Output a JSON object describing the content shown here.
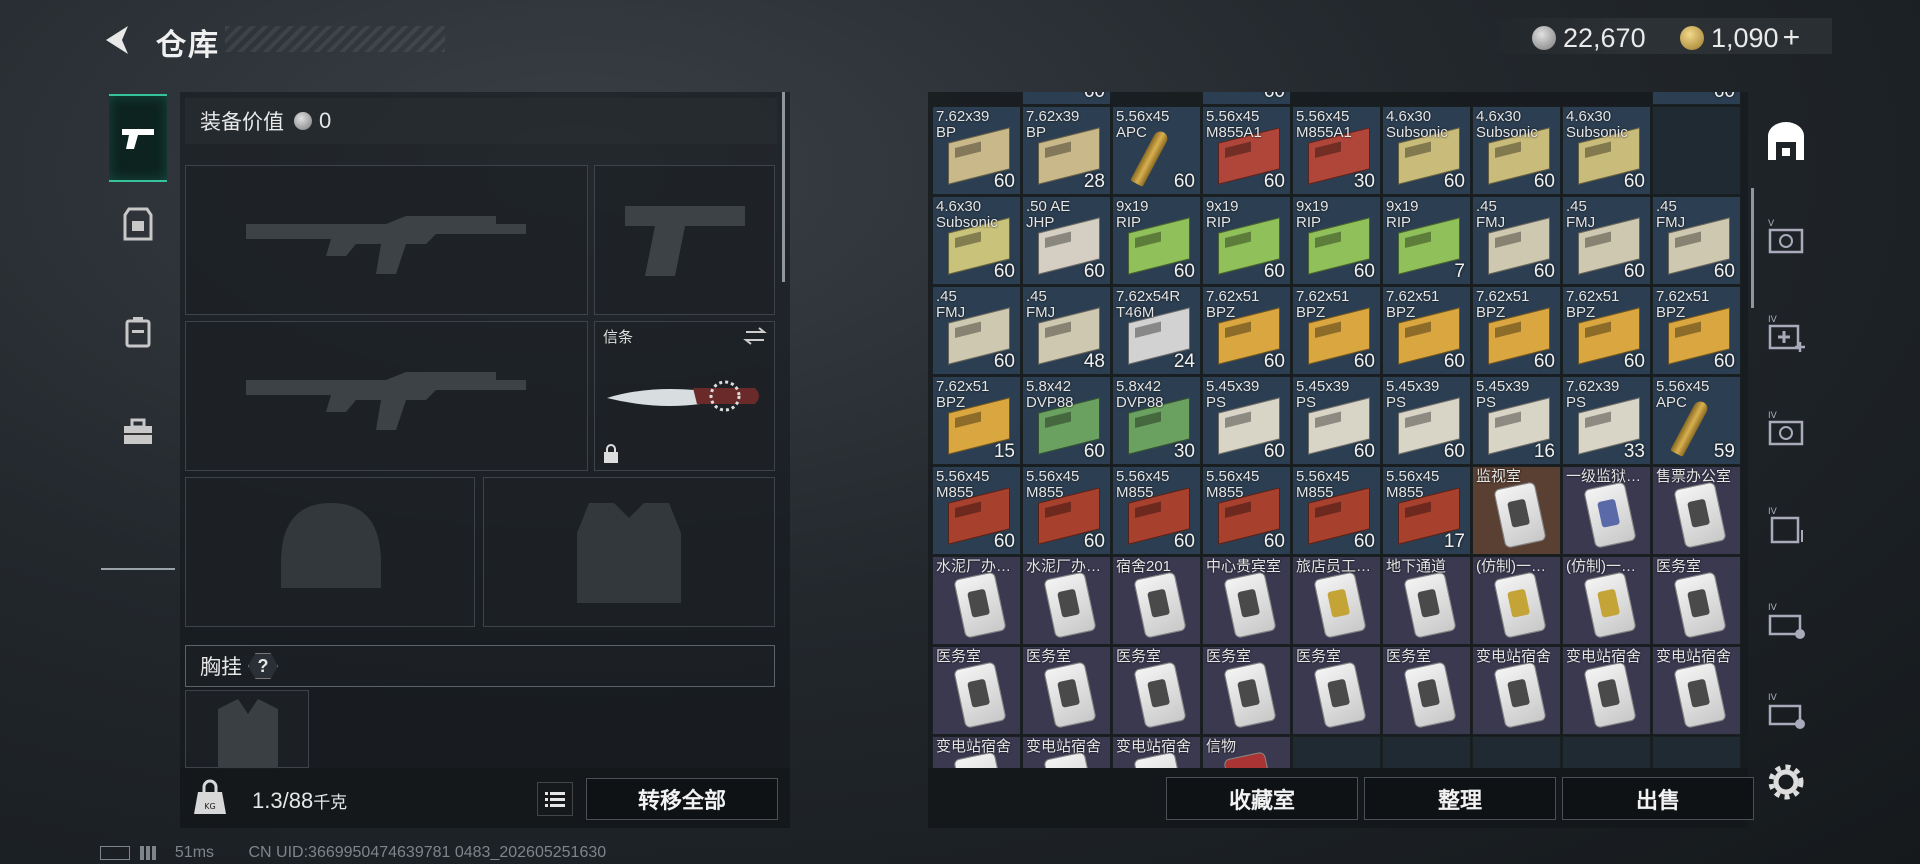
{
  "header": {
    "title": "仓库",
    "currency_silver": "22,670",
    "currency_gold": "1,090",
    "plus": "+"
  },
  "loadout": {
    "equip_value_label": "装备价值",
    "equip_value": "0",
    "knife_label": "信条",
    "chest_label": "胸挂",
    "chest_help": "?",
    "weight_current": "1.3",
    "weight_max": "/88",
    "weight_unit": "千克",
    "transfer_all": "转移全部"
  },
  "actions": {
    "collection_room": "收藏室",
    "organize": "整理",
    "sell": "出售"
  },
  "status": {
    "ping": "51ms",
    "uid": "CN UID:3669950474639781 0483_202605251630"
  },
  "colors": {
    "accent": "#36c39a",
    "ammo_slot": "#2c3f52",
    "key_slot": "#3a3950"
  },
  "inventory": {
    "top_partial": [
      "60",
      "60",
      "60"
    ],
    "rows": [
      [
        {
          "name": "7.62x39\nBP",
          "count": "60",
          "icon": "ammo-box",
          "tint": "#c9b98a"
        },
        {
          "name": "7.62x39\nBP",
          "count": "28",
          "icon": "ammo-box",
          "tint": "#c9b98a"
        },
        {
          "name": "5.56x45\nAPC",
          "count": "60",
          "icon": "bullet",
          "tint": "#9b3a2a"
        },
        {
          "name": "5.56x45\nM855A1",
          "count": "60",
          "icon": "ammo-box",
          "tint": "#b0453a"
        },
        {
          "name": "5.56x45\nM855A1",
          "count": "30",
          "icon": "ammo-box",
          "tint": "#b0453a"
        },
        {
          "name": "4.6x30\nSubsonic",
          "count": "60",
          "icon": "ammo-box",
          "tint": "#c9bb7a"
        },
        {
          "name": "4.6x30\nSubsonic",
          "count": "60",
          "icon": "ammo-box",
          "tint": "#c9bb7a"
        },
        {
          "name": "4.6x30\nSubsonic",
          "count": "60",
          "icon": "ammo-box",
          "tint": "#c9bb7a"
        }
      ],
      [
        {
          "name": "4.6x30\nSubsonic",
          "count": "60",
          "icon": "ammo-box",
          "tint": "#c9c27a"
        },
        {
          "name": ".50 AE\nJHP",
          "count": "60",
          "icon": "ammo-box",
          "tint": "#d4cfc2"
        },
        {
          "name": "9x19\nRIP",
          "count": "60",
          "icon": "ammo-box",
          "tint": "#8fc05a"
        },
        {
          "name": "9x19\nRIP",
          "count": "60",
          "icon": "ammo-box",
          "tint": "#8fc05a"
        },
        {
          "name": "9x19\nRIP",
          "count": "60",
          "icon": "ammo-box",
          "tint": "#8fc05a"
        },
        {
          "name": "9x19\nRIP",
          "count": "7",
          "icon": "ammo-box",
          "tint": "#8fc05a"
        },
        {
          "name": ".45\nFMJ",
          "count": "60",
          "icon": "ammo-box",
          "tint": "#cfc8b0"
        },
        {
          "name": ".45\nFMJ",
          "count": "60",
          "icon": "ammo-box",
          "tint": "#cfc8b0"
        },
        {
          "name": ".45\nFMJ",
          "count": "60",
          "icon": "ammo-box",
          "tint": "#cfc8b0"
        }
      ],
      [
        {
          "name": ".45\nFMJ",
          "count": "60",
          "icon": "ammo-box",
          "tint": "#cfc8b0"
        },
        {
          "name": ".45\nFMJ",
          "count": "48",
          "icon": "ammo-box",
          "tint": "#cfc8b0"
        },
        {
          "name": "7.62x54R\nT46M",
          "count": "24",
          "icon": "ammo-box",
          "tint": "#d2d2d2"
        },
        {
          "name": "7.62x51\nBPZ",
          "count": "60",
          "icon": "ammo-box",
          "tint": "#d9a640"
        },
        {
          "name": "7.62x51\nBPZ",
          "count": "60",
          "icon": "ammo-box",
          "tint": "#d9a640"
        },
        {
          "name": "7.62x51\nBPZ",
          "count": "60",
          "icon": "ammo-box",
          "tint": "#d9a640"
        },
        {
          "name": "7.62x51\nBPZ",
          "count": "60",
          "icon": "ammo-box",
          "tint": "#d9a640"
        },
        {
          "name": "7.62x51\nBPZ",
          "count": "60",
          "icon": "ammo-box",
          "tint": "#d9a640"
        },
        {
          "name": "7.62x51\nBPZ",
          "count": "60",
          "icon": "ammo-box",
          "tint": "#d9a640"
        }
      ],
      [
        {
          "name": "7.62x51\nBPZ",
          "count": "15",
          "icon": "ammo-box",
          "tint": "#d9a640"
        },
        {
          "name": "5.8x42\nDVP88",
          "count": "60",
          "icon": "ammo-box",
          "tint": "#6aa060"
        },
        {
          "name": "5.8x42\nDVP88",
          "count": "30",
          "icon": "ammo-box",
          "tint": "#6aa060"
        },
        {
          "name": "5.45x39\nPS",
          "count": "60",
          "icon": "ammo-box",
          "tint": "#d8d4c6"
        },
        {
          "name": "5.45x39\nPS",
          "count": "60",
          "icon": "ammo-box",
          "tint": "#d8d4c6"
        },
        {
          "name": "5.45x39\nPS",
          "count": "60",
          "icon": "ammo-box",
          "tint": "#d8d4c6"
        },
        {
          "name": "5.45x39\nPS",
          "count": "16",
          "icon": "ammo-box",
          "tint": "#d8d4c6"
        },
        {
          "name": "7.62x39\nPS",
          "count": "33",
          "icon": "ammo-box",
          "tint": "#d8d4c6"
        },
        {
          "name": "5.56x45\nAPC",
          "count": "59",
          "icon": "bullet",
          "tint": "#9b3a2a"
        }
      ],
      [
        {
          "name": "5.56x45\nM855",
          "count": "60",
          "icon": "ammo-box",
          "tint": "#a8402e"
        },
        {
          "name": "5.56x45\nM855",
          "count": "60",
          "icon": "ammo-box",
          "tint": "#a8402e"
        },
        {
          "name": "5.56x45\nM855",
          "count": "60",
          "icon": "ammo-box",
          "tint": "#a8402e"
        },
        {
          "name": "5.56x45\nM855",
          "count": "60",
          "icon": "ammo-box",
          "tint": "#a8402e"
        },
        {
          "name": "5.56x45\nM855",
          "count": "60",
          "icon": "ammo-box",
          "tint": "#a8402e"
        },
        {
          "name": "5.56x45\nM855",
          "count": "17",
          "icon": "ammo-box",
          "tint": "#a8402e"
        },
        {
          "name": "监视室",
          "count": "",
          "icon": "keycard",
          "slot": "gold"
        },
        {
          "name": "一级监狱…",
          "count": "",
          "icon": "keycard-blue",
          "slot": "key"
        },
        {
          "name": "售票办公室",
          "count": "",
          "icon": "keycard",
          "slot": "key"
        }
      ],
      [
        {
          "name": "水泥厂办…",
          "count": "",
          "icon": "keycard",
          "slot": "key"
        },
        {
          "name": "水泥厂办…",
          "count": "",
          "icon": "keycard",
          "slot": "key"
        },
        {
          "name": "宿舍201",
          "count": "",
          "icon": "keycard",
          "slot": "key"
        },
        {
          "name": "中心贵宾室",
          "count": "",
          "icon": "keycard",
          "slot": "key"
        },
        {
          "name": "旅店员工…",
          "count": "",
          "icon": "keycard-yellow",
          "slot": "key"
        },
        {
          "name": "地下通道",
          "count": "",
          "icon": "keycard",
          "slot": "key"
        },
        {
          "name": "(仿制)一…",
          "count": "",
          "icon": "keycard-yellow",
          "slot": "key"
        },
        {
          "name": "(仿制)一…",
          "count": "",
          "icon": "keycard-yellow",
          "slot": "key"
        },
        {
          "name": "医务室",
          "count": "",
          "icon": "keycard",
          "slot": "key"
        }
      ],
      [
        {
          "name": "医务室",
          "count": "",
          "icon": "keycard",
          "slot": "key"
        },
        {
          "name": "医务室",
          "count": "",
          "icon": "keycard",
          "slot": "key"
        },
        {
          "name": "医务室",
          "count": "",
          "icon": "keycard",
          "slot": "key"
        },
        {
          "name": "医务室",
          "count": "",
          "icon": "keycard",
          "slot": "key"
        },
        {
          "name": "医务室",
          "count": "",
          "icon": "keycard",
          "slot": "key"
        },
        {
          "name": "医务室",
          "count": "",
          "icon": "keycard",
          "slot": "key"
        },
        {
          "name": "变电站宿舍",
          "count": "",
          "icon": "keycard",
          "slot": "key"
        },
        {
          "name": "变电站宿舍",
          "count": "",
          "icon": "keycard",
          "slot": "key"
        },
        {
          "name": "变电站宿舍",
          "count": "",
          "icon": "keycard",
          "slot": "key"
        }
      ],
      [
        {
          "name": "变电站宿舍",
          "count": "",
          "icon": "keycard",
          "slot": "key"
        },
        {
          "name": "变电站宿舍",
          "count": "",
          "icon": "keycard",
          "slot": "key"
        },
        {
          "name": "变电站宿舍",
          "count": "",
          "icon": "keycard",
          "slot": "key"
        },
        {
          "name": "信物",
          "count": "",
          "icon": "token",
          "slot": "key"
        }
      ]
    ]
  }
}
